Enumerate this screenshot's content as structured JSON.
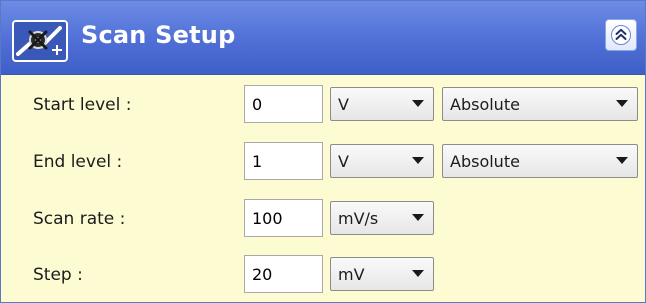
{
  "panel": {
    "title": "Scan Setup",
    "colors": {
      "header": "#4f6fd6",
      "body": "#fdfbd2",
      "border": "#5a78c4"
    },
    "header_icon": "scan-setup-icon",
    "collapse_icon": "double-chevron-up-icon"
  },
  "rows": {
    "start": {
      "label": "Start level :",
      "value": "0",
      "unit": "V",
      "mode": "Absolute"
    },
    "end": {
      "label": "End level :",
      "value": "1",
      "unit": "V",
      "mode": "Absolute"
    },
    "rate": {
      "label": "Scan rate :",
      "value": "100",
      "unit": "mV/s"
    },
    "step": {
      "label": "Step :",
      "value": "20",
      "unit": "mV"
    }
  }
}
